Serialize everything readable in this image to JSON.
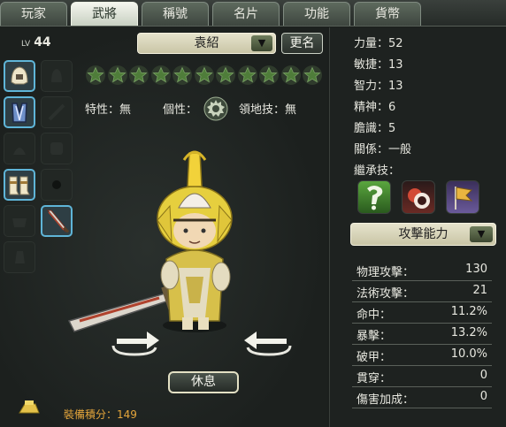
{
  "tabs": [
    {
      "label": "玩家"
    },
    {
      "label": "武將"
    },
    {
      "label": "稱號"
    },
    {
      "label": "名片"
    },
    {
      "label": "功能"
    },
    {
      "label": "貨幣"
    }
  ],
  "general": {
    "level_prefix": "LV",
    "level": "44",
    "name": "袁紹",
    "rename_label": "更名",
    "stars_filled": 0,
    "stars_total": 11,
    "trait_label": "特性：無",
    "personality_label": "個性：",
    "territory_label": "領地技：無",
    "rest_label": "休息",
    "equip_score_label": "裝備積分：149"
  },
  "attributes": [
    {
      "label": "力量：52"
    },
    {
      "label": "敏捷：13"
    },
    {
      "label": "智力：13"
    },
    {
      "label": "精神：6"
    },
    {
      "label": "膽識：5"
    },
    {
      "label": "關係：一般"
    },
    {
      "label": "繼承技："
    }
  ],
  "inherited_skills": [
    {
      "icon": "green-question-skill-icon",
      "color": "#3d8a2f"
    },
    {
      "icon": "red-dark-skill-icon",
      "color": "#8a2d22"
    },
    {
      "icon": "flag-skill-icon",
      "color": "#4a3f7a"
    }
  ],
  "section": {
    "label": "攻擊能力"
  },
  "stats": [
    {
      "name": "物理攻擊：",
      "value": "130"
    },
    {
      "name": "法術攻擊：",
      "value": "21"
    },
    {
      "name": "命中：",
      "value": "11.2%"
    },
    {
      "name": "暴擊：",
      "value": "13.2%"
    },
    {
      "name": "破甲：",
      "value": "10.0%"
    },
    {
      "name": "貫穿：",
      "value": "0"
    },
    {
      "name": "傷害加成：",
      "value": "0"
    }
  ],
  "equipment_slots": [
    {
      "icon": "helmet-icon",
      "filled": true
    },
    {
      "icon": "empty-slot-icon",
      "filled": false
    },
    {
      "icon": "armor-icon",
      "filled": true
    },
    {
      "icon": "empty-slot-icon",
      "filled": false
    },
    {
      "icon": "empty-slot-icon",
      "filled": false
    },
    {
      "icon": "empty-slot-icon",
      "filled": false
    },
    {
      "icon": "boots-icon",
      "filled": true
    },
    {
      "icon": "empty-slot-icon",
      "filled": false
    },
    {
      "icon": "empty-slot-icon",
      "filled": false
    },
    {
      "icon": "sword-icon",
      "filled": true
    },
    {
      "icon": "empty-slot-icon",
      "filled": false
    }
  ],
  "colors": {
    "accent_cyan": "#5fb5d8",
    "score_orange": "#e5a63b",
    "star_green": "#4f7d3a"
  }
}
